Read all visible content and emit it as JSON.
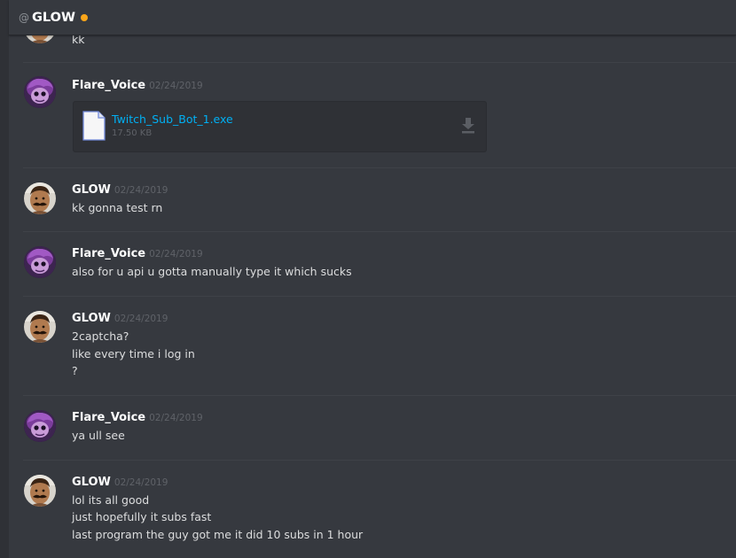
{
  "header": {
    "at_symbol": "@",
    "title": "GLOW",
    "status_color": "#faa61a"
  },
  "messages": [
    {
      "author": "",
      "timestamp": "",
      "lines": [
        "kk"
      ]
    },
    {
      "author": "Flare_Voice",
      "timestamp": "02/24/2019",
      "lines": [],
      "attachment": {
        "filename": "Twitch_Sub_Bot_1.exe",
        "size": "17.50 KB"
      }
    },
    {
      "author": "GLOW",
      "timestamp": "02/24/2019",
      "lines": [
        "kk gonna test rn"
      ]
    },
    {
      "author": "Flare_Voice",
      "timestamp": "02/24/2019",
      "lines": [
        "also for u api u gotta manually type it which sucks"
      ]
    },
    {
      "author": "GLOW",
      "timestamp": "02/24/2019",
      "lines": [
        "2captcha?",
        "like every time i log in",
        "?"
      ]
    },
    {
      "author": "Flare_Voice",
      "timestamp": "02/24/2019",
      "lines": [
        "ya ull see"
      ]
    },
    {
      "author": "GLOW",
      "timestamp": "02/24/2019",
      "lines": [
        "lol its all good",
        "just hopefully it subs fast",
        "last program the guy got me it did 10 subs in 1 hour"
      ]
    }
  ]
}
